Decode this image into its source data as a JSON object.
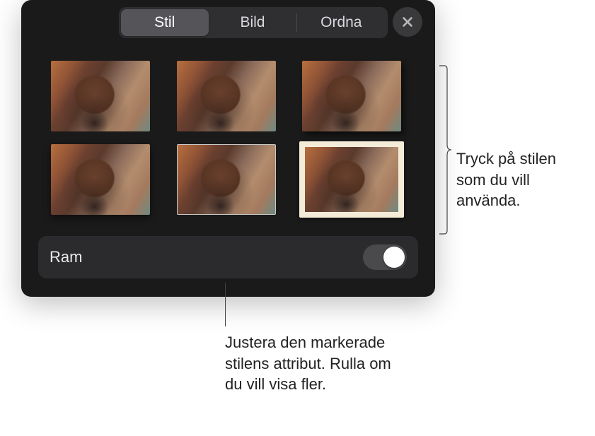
{
  "tabs": {
    "stil": "Stil",
    "bild": "Bild",
    "ordna": "Ordna",
    "active": "stil"
  },
  "ram": {
    "label": "Ram",
    "on": true
  },
  "callouts": {
    "right": "Tryck på stilen som du vill använda.",
    "bottom": "Justera den markerade stilens attribut. Rulla om du vill visa fler."
  },
  "styles": [
    {
      "id": "plain",
      "variant": "plain"
    },
    {
      "id": "reflect",
      "variant": "reflect"
    },
    {
      "id": "dropshadow",
      "variant": "dropshadow"
    },
    {
      "id": "shadow1",
      "variant": "shadow1"
    },
    {
      "id": "thinborder",
      "variant": "thinborder"
    },
    {
      "id": "photoframe",
      "variant": "photoframe",
      "selected": true
    }
  ]
}
